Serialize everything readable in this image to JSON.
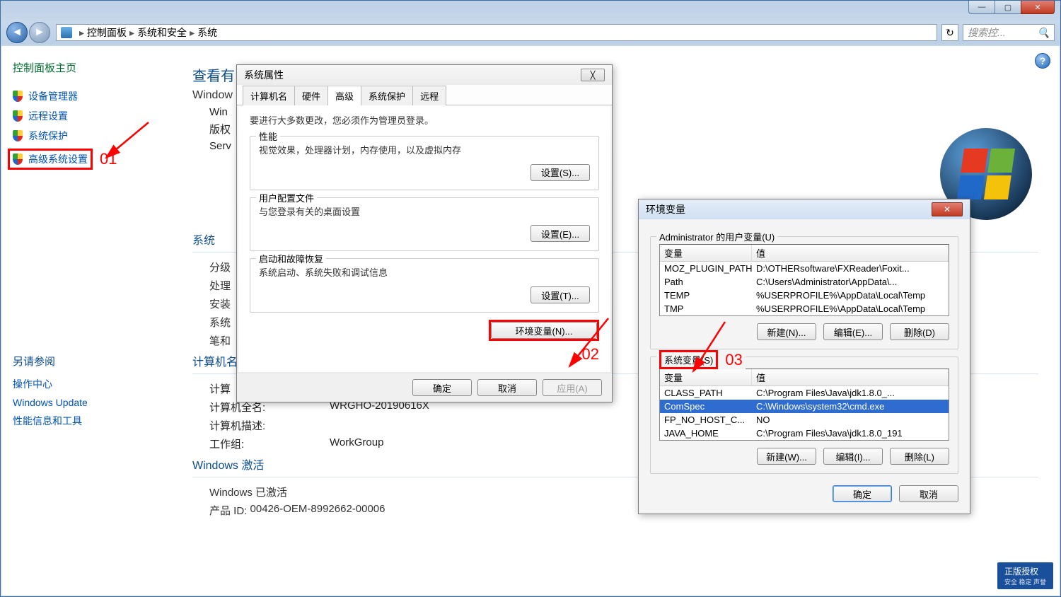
{
  "window": {
    "breadcrumb": {
      "icon": "computer",
      "items": [
        "控制面板",
        "系统和安全",
        "系统"
      ]
    },
    "search_placeholder": "搜索控...",
    "minimize": "—",
    "maximize": "▢",
    "close": "✕"
  },
  "sidebar": {
    "home": "控制面板主页",
    "links": [
      {
        "label": "设备管理器"
      },
      {
        "label": "远程设置"
      },
      {
        "label": "系统保护"
      },
      {
        "label": "高级系统设置"
      }
    ],
    "annotation_01": "01",
    "see_also_title": "另请参阅",
    "see_also": [
      "操作中心",
      "Windows Update",
      "性能信息和工具"
    ]
  },
  "main": {
    "view_heading": "查看有",
    "windows_edition_title": "Window",
    "win_line": "Win",
    "version_label": "版权",
    "serv_line": "Serv",
    "system_section": "系统",
    "rating_label": "分级",
    "processor_label": "处理",
    "memory_label": "安装",
    "systype_label": "系统",
    "pentouch_label": "笔和",
    "computer_section": "计算机名",
    "computer_label": "计算",
    "fullname_label": "计算机全名:",
    "fullname_value": "WRGHO-20190616X",
    "description_label": "计算机描述:",
    "description_value": "",
    "workgroup_label": "工作组:",
    "workgroup_value": "WorkGroup",
    "activation_section": "Windows 激活",
    "activation_status": "Windows 已激活",
    "product_id_label": "产品 ID:",
    "product_id_value": "00426-OEM-8992662-00006",
    "genuine_badge": "正版授权",
    "genuine_sub": "安全 稳定 声誉",
    "help_icon": "?"
  },
  "sysprops_dialog": {
    "title": "系统属性",
    "tabs": [
      "计算机名",
      "硬件",
      "高级",
      "系统保护",
      "远程"
    ],
    "active_tab": 2,
    "admin_note": "要进行大多数更改，您必须作为管理员登录。",
    "groups": {
      "performance": {
        "legend": "性能",
        "desc": "视觉效果，处理器计划，内存使用，以及虚拟内存",
        "btn": "设置(S)..."
      },
      "profiles": {
        "legend": "用户配置文件",
        "desc": "与您登录有关的桌面设置",
        "btn": "设置(E)..."
      },
      "startup": {
        "legend": "启动和故障恢复",
        "desc": "系统启动、系统失败和调试信息",
        "btn": "设置(T)..."
      }
    },
    "env_btn": "环境变量(N)...",
    "annotation_02": "02",
    "ok": "确定",
    "cancel": "取消",
    "apply": "应用(A)",
    "close_x": "╳"
  },
  "env_dialog": {
    "title": "环境变量",
    "close_x": "✕",
    "user_section": "Administrator 的用户变量(U)",
    "header_name": "变量",
    "header_value": "值",
    "user_vars": [
      {
        "name": "MOZ_PLUGIN_PATH",
        "value": "D:\\OTHERsoftware\\FXReader\\Foxit..."
      },
      {
        "name": "Path",
        "value": "C:\\Users\\Administrator\\AppData\\..."
      },
      {
        "name": "TEMP",
        "value": "%USERPROFILE%\\AppData\\Local\\Temp"
      },
      {
        "name": "TMP",
        "value": "%USERPROFILE%\\AppData\\Local\\Temp"
      }
    ],
    "user_btns": {
      "new": "新建(N)...",
      "edit": "编辑(E)...",
      "del": "删除(D)"
    },
    "sys_section": "系统变量(S)",
    "annotation_03": "03",
    "sys_vars": [
      {
        "name": "CLASS_PATH",
        "value": "C:\\Program Files\\Java\\jdk1.8.0_...",
        "selected": false
      },
      {
        "name": "ComSpec",
        "value": "C:\\Windows\\system32\\cmd.exe",
        "selected": true
      },
      {
        "name": "FP_NO_HOST_C...",
        "value": "NO",
        "selected": false
      },
      {
        "name": "JAVA_HOME",
        "value": "C:\\Program Files\\Java\\jdk1.8.0_191",
        "selected": false
      }
    ],
    "sys_btns": {
      "new": "新建(W)...",
      "edit": "编辑(I)...",
      "del": "删除(L)"
    },
    "ok": "确定",
    "cancel": "取消"
  }
}
